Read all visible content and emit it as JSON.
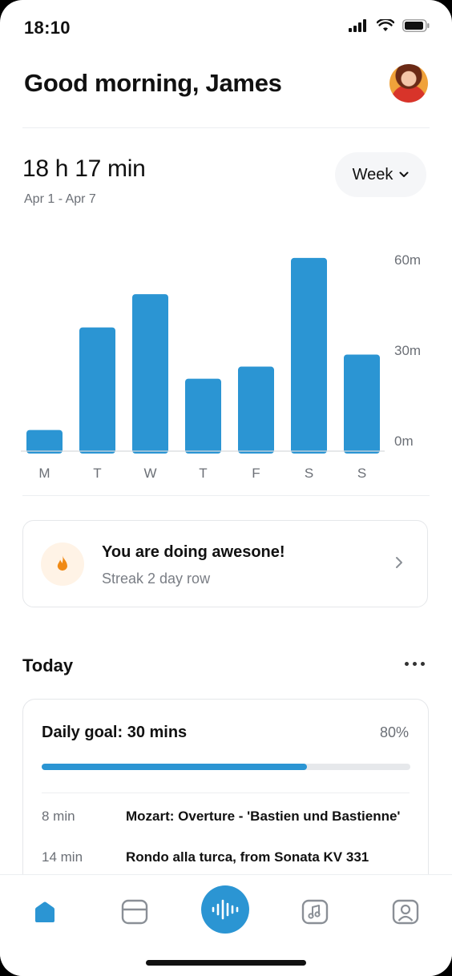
{
  "status_bar": {
    "time": "18:10",
    "signal_icon": "signal-icon",
    "wifi_icon": "wifi-icon",
    "battery_icon": "battery-icon"
  },
  "header": {
    "greeting": "Good morning, James",
    "avatar_icon": "avatar"
  },
  "summary": {
    "total": "18 h 17 min",
    "range": "Apr 1 - Apr 7",
    "period": "Week"
  },
  "chart_data": {
    "type": "bar",
    "categories": [
      "M",
      "T",
      "W",
      "T",
      "F",
      "S",
      "S"
    ],
    "values": [
      7,
      41,
      52,
      24,
      28,
      64,
      32
    ],
    "ylim": [
      0,
      60
    ],
    "yticks": [
      "0m",
      "30m",
      "60m"
    ],
    "grid": false,
    "color": "#2b95d3"
  },
  "streak": {
    "title": "You are doing awesone!",
    "subtitle": "Streak 2 day row",
    "icon": "flame-icon"
  },
  "today": {
    "title": "Today",
    "goal_label": "Daily goal: 30 mins",
    "goal_percent": "80%",
    "progress_fraction": 0.72,
    "sessions": [
      {
        "duration": "8 min",
        "name": "Mozart: Overture - 'Bastien und Bastienne'"
      },
      {
        "duration": "14 min",
        "name": "Rondo alla turca, from Sonata KV 331"
      }
    ]
  },
  "tabbar": {
    "items": [
      "home-icon",
      "library-icon",
      "record-icon",
      "music-icon",
      "profile-icon"
    ],
    "accent": "#2b95d3",
    "inactive": "#8a8f96"
  }
}
